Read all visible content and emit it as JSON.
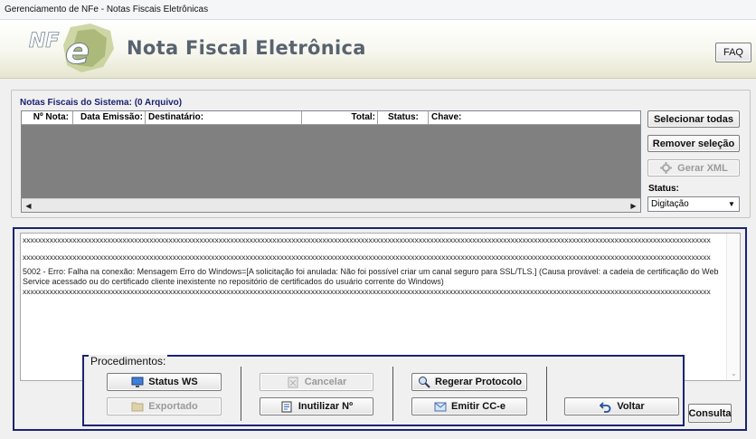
{
  "window": {
    "title": "Gerenciamento de NFe - Notas Fiscais Eletrônicas"
  },
  "banner": {
    "logo_text": "NF e",
    "title": "Nota Fiscal Eletrônica",
    "faq_label": "FAQ"
  },
  "notas": {
    "group_title": "Notas Fiscais do Sistema: (0 Arquivo)",
    "columns": [
      "Nº Nota:",
      "Data Emissão:",
      "Destinatário:",
      "Total:",
      "Status:",
      "Chave:"
    ],
    "rows": []
  },
  "side": {
    "select_all": "Selecionar todas",
    "remove_selection": "Remover seleção",
    "generate_xml": "Gerar XML",
    "status_label": "Status:",
    "status_value": "Digitação"
  },
  "log": {
    "lines": [
      "xxxxxxxxxxxxxxxxxxxxxxxxxxxxxxxxxxxxxxxxxxxxxxxxxxxxxxxxxxxxxxxxxxxxxxxxxxxxxxxxxxxxxxxxxxxxxxxxxxxxxxxxxxxxxxxxxxxxxxxxxxxxxxxxxxxxxxxxxxxxxxxxxxxxxxxxxxxxxxxxxxxxxxxxxxxxxxxxxxx",
      "",
      "xxxxxxxxxxxxxxxxxxxxxxxxxxxxxxxxxxxxxxxxxxxxxxxxxxxxxxxxxxxxxxxxxxxxxxxxxxxxxxxxxxxxxxxxxxxxxxxxxxxxxxxxxxxxxxxxxxxxxxxxxxxxxxxxxxxxxxxxxxxxxxxxxxxxxxxxxxxxxxxxxxxxxxxxxxxxxxxxxxx",
      "5002 - Erro: Falha na conexão: Mensagem Erro do Windows=[A solicitação foi anulada: Não foi possível criar um canal seguro para SSL/TLS.] (Causa provável: a cadeia de certificação do Web Service acessado ou do certificado cliente inexistente no repositório de certificados do usuário corrente do Windows)",
      "xxxxxxxxxxxxxxxxxxxxxxxxxxxxxxxxxxxxxxxxxxxxxxxxxxxxxxxxxxxxxxxxxxxxxxxxxxxxxxxxxxxxxxxxxxxxxxxxxxxxxxxxxxxxxxxxxxxxxxxxxxxxxxxxxxxxxxxxxxxxxxxxxxxxxxxxxxxxxxxxxxxxxxxxxxxxxxxxxxx"
    ]
  },
  "procedimentos": {
    "title": "Procedimentos:",
    "status_ws": "Status WS",
    "exportado": "Exportado",
    "cancelar": "Cancelar",
    "inutilizar": "Inutilizar Nº",
    "regerar": "Regerar Protocolo",
    "emitir_cce": "Emitir CC-e",
    "voltar": "Voltar"
  },
  "consulta_label": "Consulta",
  "colors": {
    "frame_blue": "#1b2470",
    "grid_bg": "#808080",
    "banner_title": "#58636f"
  }
}
